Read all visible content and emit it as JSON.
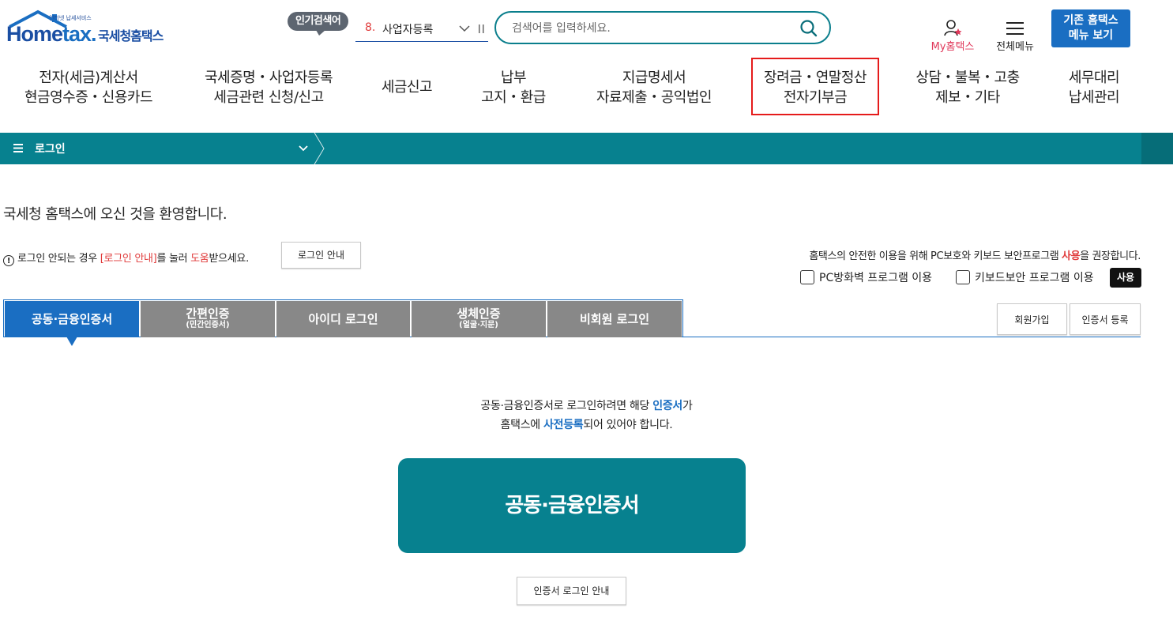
{
  "header": {
    "logo_small": "인터넷 납세서비스",
    "logo_home": "Home",
    "logo_tax": "tax.",
    "logo_kr": "국세청홈택스",
    "popular_badge": "인기검색어",
    "popular_rank": "8.",
    "popular_word": "사업자등록",
    "search_placeholder": "검색어를 입력하세요.",
    "myhome_label": "My홈택스",
    "allmenu_label": "전체메뉴",
    "old_menu_line1": "기존 홈택스",
    "old_menu_line2": "메뉴 보기"
  },
  "nav": [
    {
      "line1": "전자(세금)계산서",
      "line2": "현금영수증・신용카드"
    },
    {
      "line1": "국세증명・사업자등록",
      "line2": "세금관련 신청/신고"
    },
    {
      "line1": "세금신고",
      "line2": ""
    },
    {
      "line1": "납부",
      "line2": "고지・환급"
    },
    {
      "line1": "지급명세서",
      "line2": "자료제출・공익법인"
    },
    {
      "line1": "장려금・연말정산",
      "line2": "전자기부금"
    },
    {
      "line1": "상담・불복・고충",
      "line2": "제보・기타"
    },
    {
      "line1": "세무대리",
      "line2": "납세관리"
    }
  ],
  "breadcrumb": {
    "label": "로그인"
  },
  "main": {
    "welcome": "국세청 홈택스에 오신 것을 환영합니다.",
    "help_pre": "로그인 안되는 경우 ",
    "help_link": "[로그인 안내]",
    "help_mid": "를 눌러 ",
    "help_red": "도움",
    "help_post": "받으세요.",
    "login_guide_btn": "로그인 안내",
    "security_pre": "홈택스의 안전한 이용을 위해 PC보호와 키보드 보안프로그램 ",
    "security_red": "사용",
    "security_post": "을 권장합니다.",
    "check_firewall": "PC방화벽 프로그램 이용",
    "check_keyboard": "키보드보안 프로그램 이용",
    "use_btn": "사용",
    "tabs": [
      {
        "label": "공동·금융인증서",
        "sub": ""
      },
      {
        "label": "간편인증",
        "sub": "(민간인증서)"
      },
      {
        "label": "아이디 로그인",
        "sub": ""
      },
      {
        "label": "생체인증",
        "sub": "(얼굴·지문)"
      },
      {
        "label": "비회원 로그인",
        "sub": ""
      }
    ],
    "join_btn": "회원가입",
    "cert_reg_btn": "인증서 등록",
    "desc1_pre": "공동·금융인증서로 로그인하려면 해당 ",
    "desc1_blue": "인증서",
    "desc1_post": "가",
    "desc2_pre": "홈택스에 ",
    "desc2_blue": "사전등록",
    "desc2_post": "되어 있어야 합니다.",
    "big_button": "공동·금융인증서",
    "cert_guide_btn": "인증서 로그인 안내"
  },
  "colors": {
    "teal": "#07818f",
    "blue": "#1a6ec2",
    "red": "#e03a3a",
    "tab_gray": "#888888"
  }
}
